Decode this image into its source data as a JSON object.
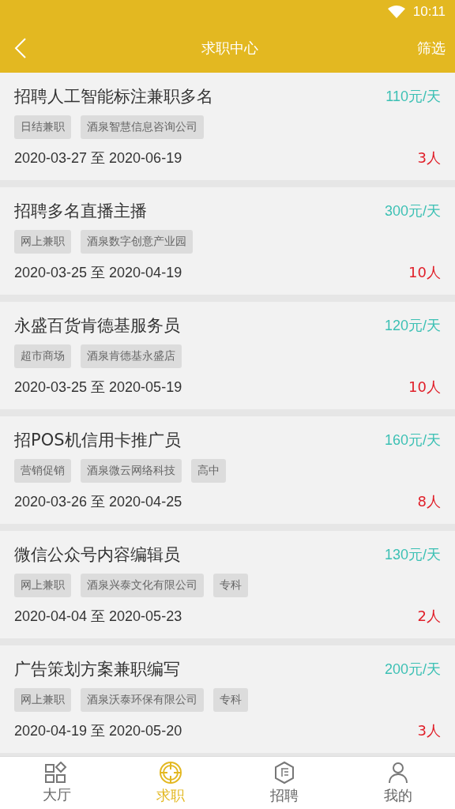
{
  "status_bar": {
    "time": "10:11"
  },
  "header": {
    "title": "求职中心",
    "action": "筛选"
  },
  "jobs": [
    {
      "title": "招聘人工智能标注兼职多名",
      "pay": "110元/天",
      "tags": [
        "日结兼职",
        "酒泉智慧信息咨询公司"
      ],
      "dates": "2020-03-27 至 2020-06-19",
      "count": "3人"
    },
    {
      "title": "招聘多名直播主播",
      "pay": "300元/天",
      "tags": [
        "网上兼职",
        "酒泉数字创意产业园"
      ],
      "dates": "2020-03-25 至 2020-04-19",
      "count": "10人"
    },
    {
      "title": "永盛百货肯德基服务员",
      "pay": "120元/天",
      "tags": [
        "超市商场",
        "酒泉肯德基永盛店"
      ],
      "dates": "2020-03-25 至 2020-05-19",
      "count": "10人"
    },
    {
      "title": "招POS机信用卡推广员",
      "pay": "160元/天",
      "tags": [
        "营销促销",
        "酒泉微云网络科技",
        "高中"
      ],
      "dates": "2020-03-26 至 2020-04-25",
      "count": "8人"
    },
    {
      "title": "微信公众号内容编辑员",
      "pay": "130元/天",
      "tags": [
        "网上兼职",
        "酒泉兴泰文化有限公司",
        "专科"
      ],
      "dates": "2020-04-04 至 2020-05-23",
      "count": "2人"
    },
    {
      "title": "广告策划方案兼职编写",
      "pay": "200元/天",
      "tags": [
        "网上兼职",
        "酒泉沃泰环保有限公司",
        "专科"
      ],
      "dates": "2020-04-19 至 2020-05-20",
      "count": "3人"
    }
  ],
  "tabs": [
    {
      "label": "大厅",
      "kind": "hall",
      "selected": false
    },
    {
      "label": "求职",
      "kind": "target",
      "selected": true
    },
    {
      "label": "招聘",
      "kind": "hire",
      "selected": false
    },
    {
      "label": "我的",
      "kind": "user",
      "selected": false
    }
  ]
}
